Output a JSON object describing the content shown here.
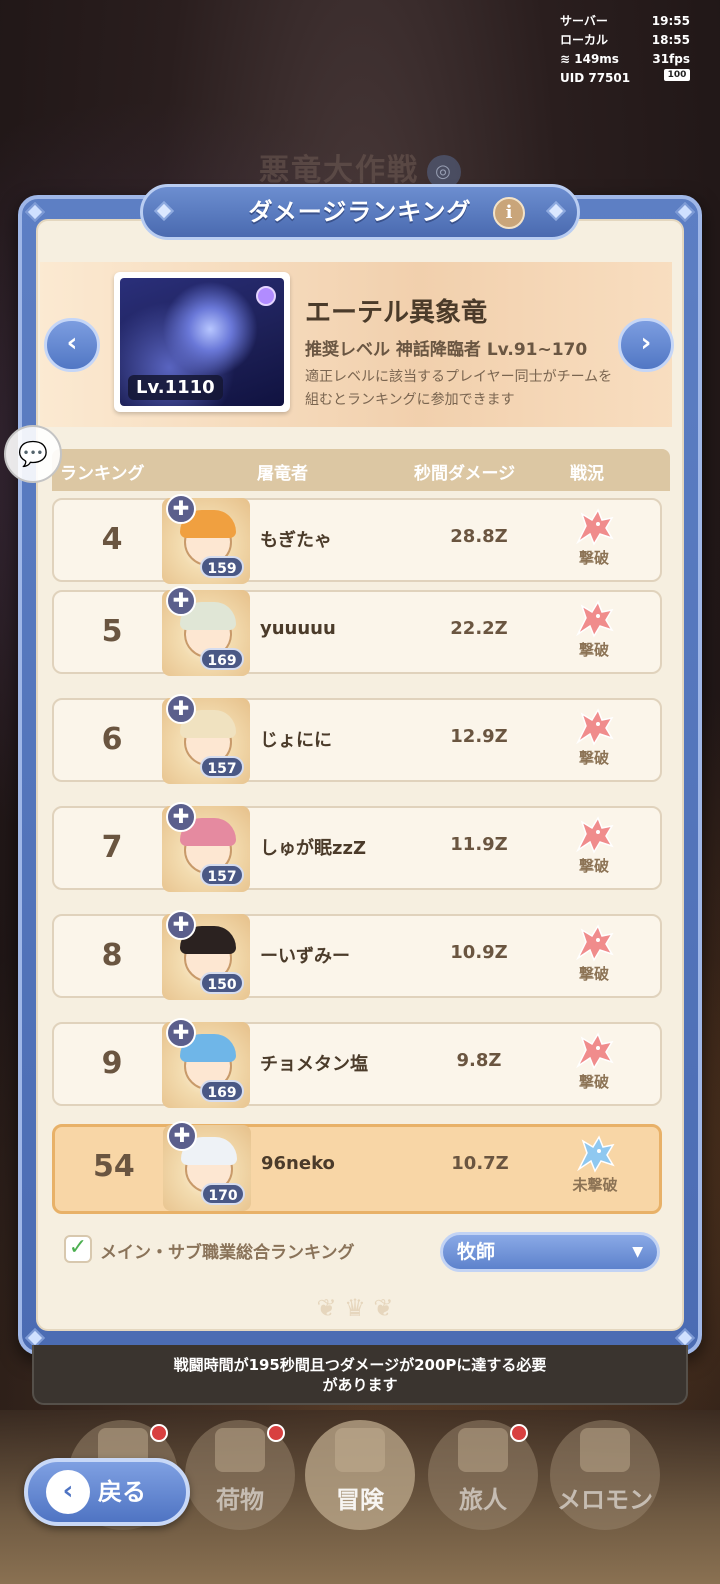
{
  "hud": {
    "server_label": "サーバー",
    "server_time": "19:55",
    "local_label": "ローカル",
    "local_time": "18:55",
    "ping": "149ms",
    "fps": "31fps",
    "uid": "UID 77501",
    "battery": "100"
  },
  "background": {
    "event_title": "悪竜大作戦"
  },
  "panel": {
    "title": "ダメージランキング",
    "info_icon": "i"
  },
  "boss": {
    "level_tag": "Lv.1110",
    "name": "エーテル異象竜",
    "recommended": "推奨レベル  神話降臨者  Lv.91~170",
    "description": "適正レベルに該当するプレイヤー同士がチームを組むとランキングに参加できます"
  },
  "table": {
    "headers": {
      "rank": "ランキング",
      "slayer": "屠竜者",
      "dps": "秒間ダメージ",
      "status": "戦況"
    },
    "rows": [
      {
        "rank": "4",
        "name": "もぎたゃ",
        "level": "159",
        "dps": "28.8Z",
        "status": "撃破",
        "hair": "#f0a040"
      },
      {
        "rank": "5",
        "name": "yuuuuu",
        "level": "169",
        "dps": "22.2Z",
        "status": "撃破",
        "hair": "#e0e6d6"
      },
      {
        "rank": "6",
        "name": "じょにに",
        "level": "157",
        "dps": "12.9Z",
        "status": "撃破",
        "hair": "#f0e2c0"
      },
      {
        "rank": "7",
        "name": "しゅが眠zzZ",
        "level": "157",
        "dps": "11.9Z",
        "status": "撃破",
        "hair": "#e58aa0"
      },
      {
        "rank": "8",
        "name": "ーいずみー",
        "level": "150",
        "dps": "10.9Z",
        "status": "撃破",
        "hair": "#2b2220"
      },
      {
        "rank": "9",
        "name": "チョメタン塩",
        "level": "169",
        "dps": "9.8Z",
        "status": "撃破",
        "hair": "#6fb6e8"
      }
    ],
    "mine": {
      "rank": "54",
      "name": "96neko",
      "level": "170",
      "dps": "10.7Z",
      "status": "未撃破",
      "hair": "#eef2f6"
    }
  },
  "controls": {
    "check_label": "メイン・サブ職業総合ランキング",
    "check_mark": "✓",
    "class_select": "牧師",
    "caret": "▼"
  },
  "notice": "戦闘時間が195秒間且つダメージが200Pに達する必要があります",
  "nav": {
    "back": "戻る",
    "items": [
      "荷物",
      "冒険",
      "旅人",
      "メロモン"
    ]
  },
  "colors": {
    "accent_blue": "#5d7fc4",
    "parchment": "#f6efe0",
    "mine_row": "#f8d6a6",
    "defeated_dragon": "#f08c8c",
    "undefeated_dragon": "#8fc8f0"
  }
}
